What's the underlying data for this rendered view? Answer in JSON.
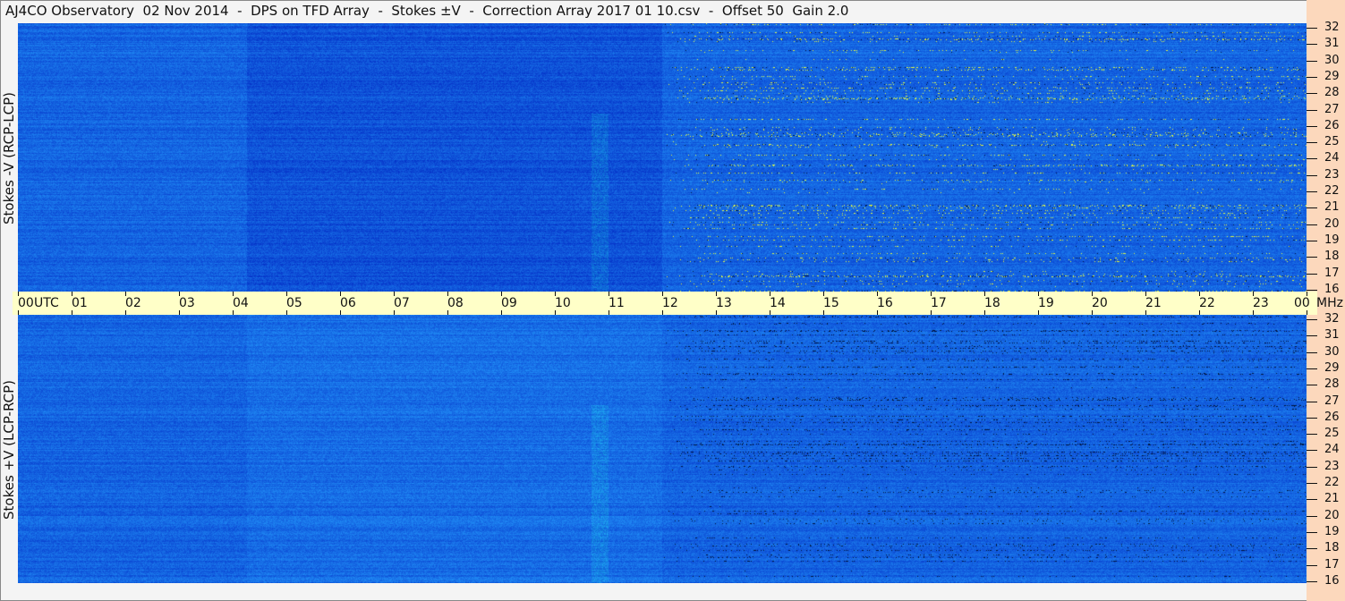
{
  "title": "AJ4CO Observatory  02 Nov 2014  -  DPS on TFD Array  -  Stokes ±V  -  Correction Array 2017 01 10.csv  -  Offset 50  Gain 2.0",
  "chart_data": {
    "type": "heatmap",
    "title": "AJ4CO Observatory  02 Nov 2014  -  DPS on TFD Array  -  Stokes ±V  -  Correction Array 2017 01 10.csv  -  Offset 50  Gain 2.0",
    "xlabel": "UTC",
    "ylabel_unit": "MHz",
    "x_ticks": [
      "00",
      "01",
      "02",
      "03",
      "04",
      "05",
      "06",
      "07",
      "08",
      "09",
      "10",
      "11",
      "12",
      "13",
      "14",
      "15",
      "16",
      "17",
      "18",
      "19",
      "20",
      "21",
      "22",
      "23",
      "00"
    ],
    "y_ticks": [
      "32",
      "31",
      "30",
      "29",
      "28",
      "27",
      "26",
      "25",
      "24",
      "23",
      "22",
      "21",
      "20",
      "19",
      "18",
      "17",
      "16"
    ],
    "xlim": [
      0,
      24
    ],
    "ylim": [
      16,
      32
    ],
    "panels": [
      {
        "name": "Stokes -V (RCP-LCP)"
      },
      {
        "name": "Stokes +V (LCP-RCP)"
      }
    ],
    "colors": {
      "base": "#1a5fe0",
      "high": "#ffff40",
      "low": "#001040"
    }
  },
  "axis": {
    "utc": "UTC",
    "mhz": "MHz"
  }
}
